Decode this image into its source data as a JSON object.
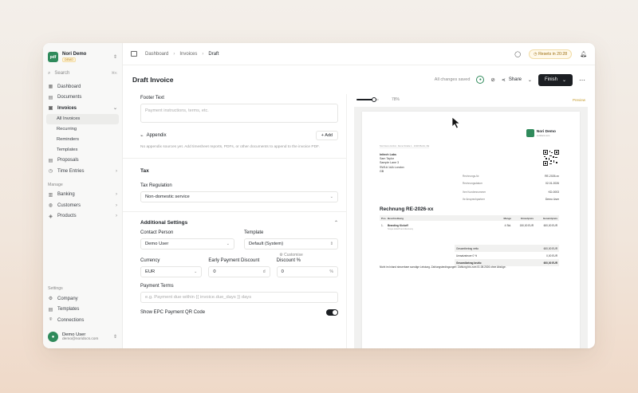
{
  "sidebar": {
    "org_name": "Nori Demo",
    "org_badge": "DEMO",
    "org_logo": "pdf",
    "search_placeholder": "Search",
    "search_shortcut": "⌘K",
    "items": [
      {
        "label": "Dashboard",
        "icon": "grid-icon"
      },
      {
        "label": "Documents",
        "icon": "document-icon"
      },
      {
        "label": "Invoices",
        "icon": "invoice-icon"
      }
    ],
    "invoice_subitems": [
      "All Invoices",
      "Recurring",
      "Reminders",
      "Templates"
    ],
    "items2": [
      {
        "label": "Proposals",
        "icon": "proposal-icon"
      },
      {
        "label": "Time Entries",
        "icon": "clock-icon"
      }
    ],
    "manage_label": "Manage",
    "manage_items": [
      {
        "label": "Banking",
        "icon": "bank-icon"
      },
      {
        "label": "Customers",
        "icon": "users-icon"
      },
      {
        "label": "Products",
        "icon": "box-icon"
      }
    ],
    "settings_label": "Settings",
    "settings_items": [
      {
        "label": "Company",
        "icon": "gear-icon"
      },
      {
        "label": "Templates",
        "icon": "template-icon"
      },
      {
        "label": "Connections",
        "icon": "pin-icon"
      }
    ],
    "user_name": "Demo User",
    "user_email": "demo@noridocs.com"
  },
  "topbar": {
    "breadcrumb": [
      "Dashboard",
      "Invoices",
      "Draft"
    ],
    "resets": "Resets in 20:28"
  },
  "header": {
    "title": "Draft Invoice",
    "saved": "All changes saved",
    "share": "Share",
    "finish": "Finish"
  },
  "form": {
    "footer_label": "Footer Text",
    "footer_placeholder": "Payment instructions, terms, etc.",
    "appendix_label": "Appendix",
    "add_label": "Add",
    "appendix_hint": "No appendix sources yet. Add timesheet reports, PDFs, or other documents to append to the invoice PDF.",
    "tax_title": "Tax",
    "tax_regulation_label": "Tax Regulation",
    "tax_regulation_value": "Non-domestic service",
    "additional_title": "Additional Settings",
    "contact_label": "Contact Person",
    "contact_value": "Demo User",
    "template_label": "Template",
    "template_value": "Default (System)",
    "customise_label": "Customise",
    "currency_label": "Currency",
    "currency_value": "EUR",
    "early_label": "Early Payment Discount",
    "early_value": "0",
    "early_unit": "d",
    "discount_label": "Discount %",
    "discount_value": "0",
    "discount_unit": "%",
    "payment_terms_label": "Payment Terms",
    "payment_terms_placeholder": "e.g. Payment due within {{ invoice.due_days }} days",
    "epc_label": "Show EPC Payment QR Code",
    "epc_enabled": true
  },
  "preview": {
    "zoom": "78%",
    "zoom_fraction": 0.78,
    "tag": "Preview",
    "logo_name": "Nori Demo",
    "logo_sub": "noridocs.com",
    "sender_line": "Nori Demo GmbH · Demo Straße 1 · 10115 Berlin, DE",
    "address": [
      "Initech Labs",
      "Sam Taylor",
      "Sample Lane 3",
      "SW1A 1AA London",
      "GB"
    ],
    "meta": [
      {
        "k": "Rechnungs-Nr.",
        "v": "RE-2026-xx"
      },
      {
        "k": "Rechnungsdatum",
        "v": "02.01.2026"
      },
      {
        "k": "Ihre Kundennummer",
        "v": "KD-0003"
      },
      {
        "k": "Ihr Ansprechpartner",
        "v": "Demo User"
      }
    ],
    "title": "Rechnung RE-2026-xx",
    "table_headers": [
      "Pos.",
      "Beschreibung",
      "Menge",
      "Einzelpreis",
      "Gesamtpreis"
    ],
    "rows": [
      {
        "pos": "1.",
        "name": "Branding Kickoff",
        "desc": "Scope kickoff and discovery",
        "qty": "4 Std.",
        "price": "150,00 EUR",
        "total": "600,00 EUR"
      }
    ],
    "sums": [
      {
        "k": "Gesamtbetrag netto",
        "v": "600,00 EUR"
      },
      {
        "k": "Umsatzsteuer 0 %",
        "v": "0,00 EUR"
      },
      {
        "k": "Gesamtbetrag brutto",
        "v": "600,00 EUR"
      }
    ],
    "footer_note": "Nicht im Inland steuerbare sonstige Leistung. Zahlungsbedingungen: Zahlung bis zum 01.08.2026 ohne Abzüge."
  }
}
